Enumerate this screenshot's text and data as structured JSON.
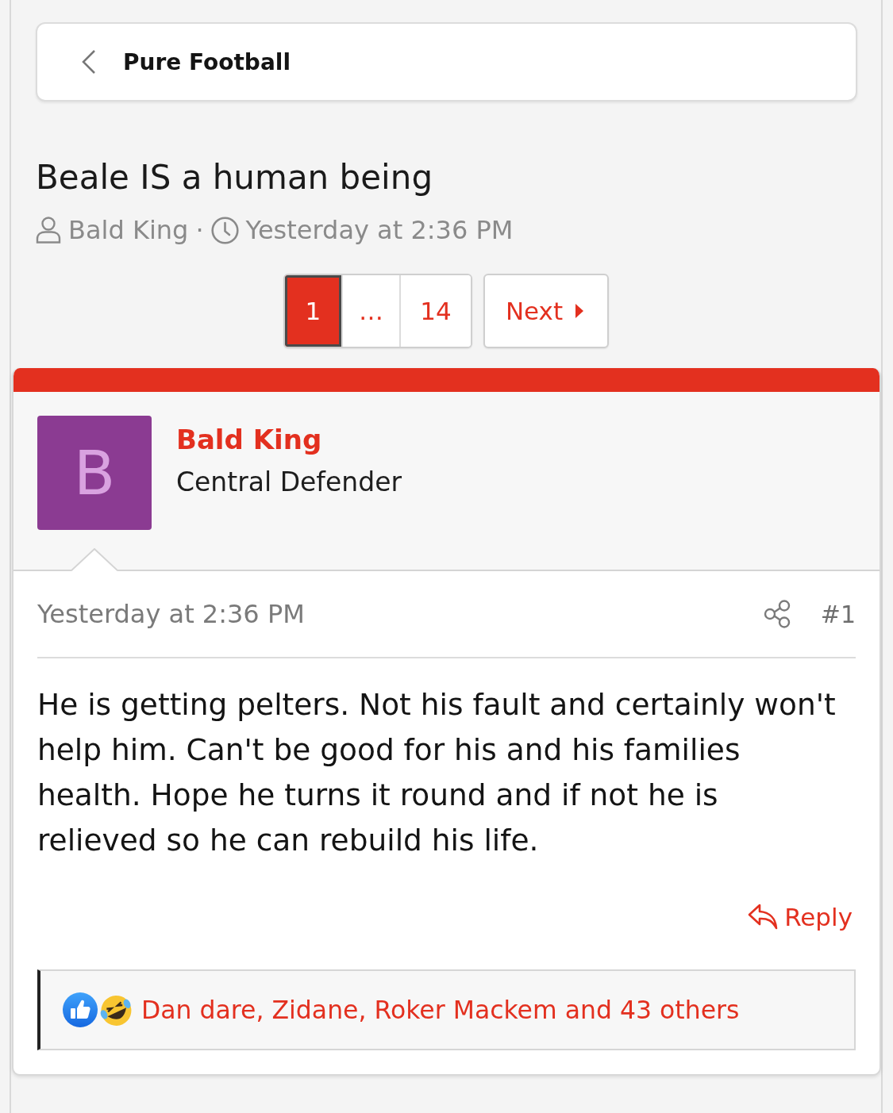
{
  "breadcrumb": {
    "label": "Pure Football"
  },
  "thread": {
    "title": "Beale IS a human being",
    "author": "Bald King",
    "separator": "·",
    "date": "Yesterday at 2:36 PM"
  },
  "pagination": {
    "pages": [
      {
        "label": "1",
        "selected": true
      },
      {
        "label": "…",
        "selected": false
      },
      {
        "label": "14",
        "selected": false
      }
    ],
    "next": "Next"
  },
  "post": {
    "author": {
      "name": "Bald King",
      "role": "Central Defender",
      "avatar_letter": "B"
    },
    "date": "Yesterday at 2:36 PM",
    "number": "#1",
    "message": "He is getting pelters. Not his fault and certainly won't help him. Can't be good for his and his families health. Hope he turns it round and if not he is relieved so he can rebuild his life.",
    "reply": "Reply",
    "reactions": {
      "text": "Dan dare, Zidane, Roker Mackem and 43 others"
    }
  }
}
